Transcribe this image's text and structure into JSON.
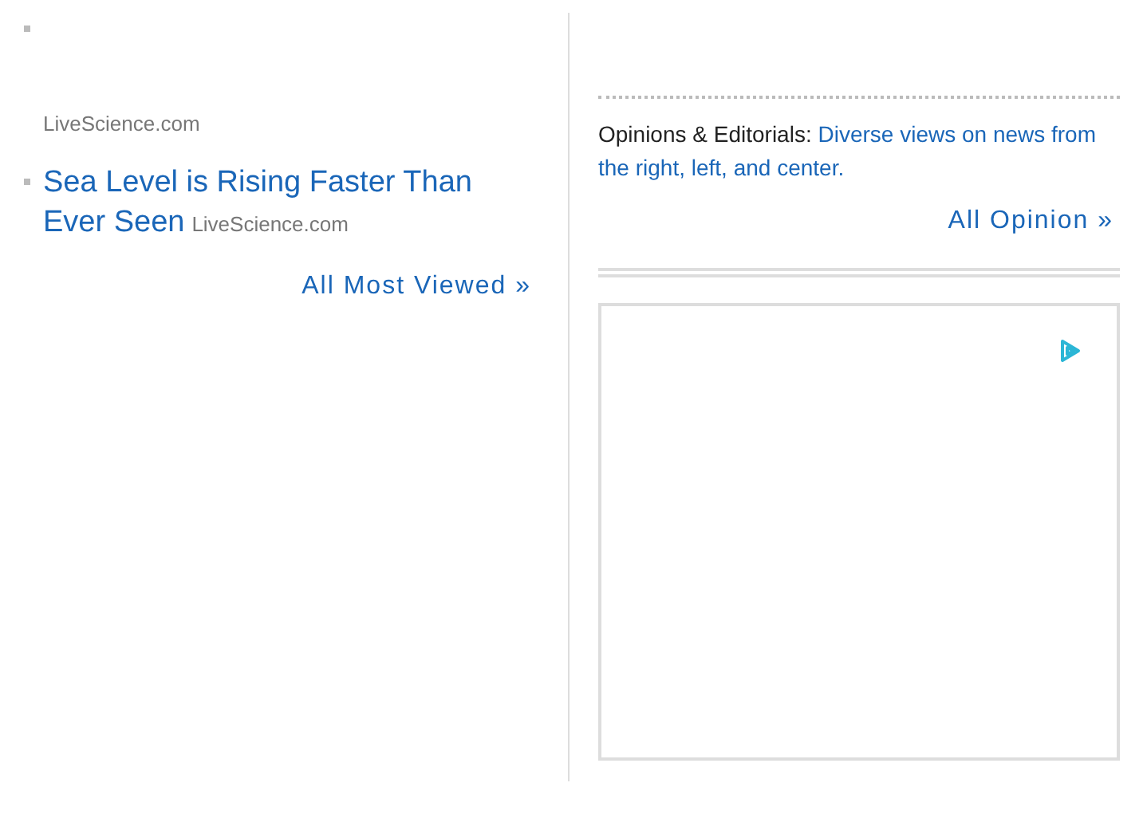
{
  "most_viewed": {
    "items": [
      {
        "kind": "source_only",
        "source": "LiveScience.com"
      },
      {
        "kind": "headline",
        "title": "Sea Level is Rising Faster Than Ever Seen",
        "source": "LiveScience.com"
      }
    ],
    "more_link": "All Most Viewed »"
  },
  "opinion": {
    "label": "Opinions & Editorials:",
    "link": "Diverse views on news from the right, left, and center.",
    "more_link": "All Opinion »"
  },
  "ad": {
    "kind": "ad_box"
  }
}
